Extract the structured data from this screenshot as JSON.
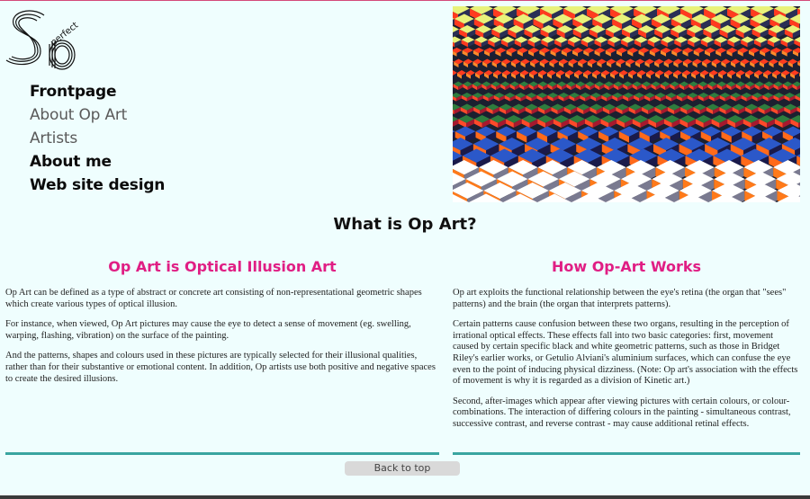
{
  "logo": {
    "text_small": "perfect",
    "text_large": "So"
  },
  "nav": {
    "items": [
      {
        "label": "Frontpage",
        "style": "dark"
      },
      {
        "label": "About Op Art",
        "style": "grey"
      },
      {
        "label": "Artists",
        "style": "grey"
      },
      {
        "label": "About me",
        "style": "dark"
      },
      {
        "label": "Web site design",
        "style": "dark"
      }
    ]
  },
  "page_title": "What is Op Art?",
  "left_column": {
    "heading": "Op Art is Optical Illusion Art",
    "paragraphs": [
      "Op Art can be defined as a type of abstract or concrete art consisting of non-representational geometric shapes which create various types of optical illusion.",
      "For instance, when viewed, Op Art pictures may cause the eye to detect a sense of movement (eg. swelling, warping, flashing, vibration) on the surface of the painting.",
      "And the patterns, shapes and colours used in these pictures are typically selected for their illusional qualities, rather than for their substantive or emotional content. In addition, Op artists use both positive and negative spaces to create the desired illusions."
    ]
  },
  "right_column": {
    "heading": "How Op-Art Works",
    "paragraphs": [
      "Op art exploits the functional relationship between the eye's retina (the organ that \"sees\" patterns) and the brain (the organ that interprets patterns).",
      "Certain patterns cause confusion between these two organs, resulting in the perception of irrational optical effects. These effects fall into two basic categories: first, movement caused by certain specific black and white geometric patterns, such as those in Bridget Riley's earlier works, or Getulio Alviani's aluminium surfaces, which can confuse the eye even to the point of inducing physical dizziness. (Note: Op art's association with the effects of movement is why it is regarded as a division of Kinetic art.)",
      "Second, after-images which appear after viewing pictures with certain colours, or colour-combinations. The interaction of differing colours in the painting - simultaneous contrast, successive contrast, and reverse contrast - may cause additional retinal effects."
    ]
  },
  "back_to_top": "Back to top",
  "colors": {
    "background": "#effefe",
    "heading_pink": "#e01e84",
    "rule_teal": "#3aa5a0",
    "nav_dark": "#0b0b0b",
    "nav_grey": "#5a5a5a"
  }
}
